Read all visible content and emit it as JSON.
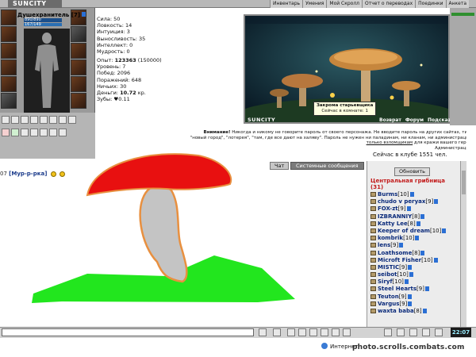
{
  "topbar": {
    "logo": "SUNCITY",
    "menu": [
      "Инвентарь",
      "Умения",
      "Мой Скролл",
      "Отчет о переводах",
      "Поединки",
      "Анкета"
    ]
  },
  "character": {
    "name": "Душехранитель",
    "level": "[7]",
    "hp": "890/890",
    "mp": "167/149"
  },
  "stats": {
    "lines": [
      "Сила: 50",
      "Ловкость: 14",
      "Интуиция: 3",
      "Выносливость: 35",
      "Интеллект: 0",
      "Мудрость: 0"
    ],
    "exp_label": "Опыт:",
    "exp_value": "123363",
    "exp_next": "(150000)",
    "level_line": "Уровень: 7",
    "wins": "Побед: 2096",
    "losses": "Поражений: 648",
    "draws": "Ничьих: 30",
    "money_label": "Деньги:",
    "money_value": "10.72",
    "money_unit": "кр.",
    "teeth": "Зубы: ♥0.11"
  },
  "scene": {
    "brand": "SUNCITY",
    "tooltip_title": "Закрома старьевщика",
    "tooltip_sub": "Сейчас в комнате: 1",
    "links": [
      "Возврат",
      "Форум",
      "Подсказка"
    ]
  },
  "warning": {
    "line1_bold": "Внимание!",
    "line1": " Никогда и никому не говорите пароль от своего персонажа. Не вводите пароль на других сайтах, типа",
    "line2": "\"новый город\", \"лотерея\", \"там, где все дают на халяву\". Пароль не нужен ни паладинам, ни кланам, ни администрации,",
    "line3a": "только взломщикам",
    "line3b": " для кражи вашего героя.",
    "line4": "Администрация."
  },
  "club_line": "Сейчас в клубе 1551 чел.",
  "tabs": {
    "chat": "Чат",
    "system": "Системные сообщения"
  },
  "chat": {
    "time": "07",
    "nick": "[Мур-р-рка]"
  },
  "room": {
    "refresh": "Обновить",
    "title": "Центральная грибница",
    "count": "(31)"
  },
  "users": [
    {
      "name": "Burms",
      "level": "[10]"
    },
    {
      "name": "chudo v peryax",
      "level": "[9]"
    },
    {
      "name": "FOX-zt",
      "level": "[9]"
    },
    {
      "name": "IZBRANNIY",
      "level": "[8]"
    },
    {
      "name": "Katty Lee",
      "level": "[8]"
    },
    {
      "name": "Keeper of dream",
      "level": "[10]"
    },
    {
      "name": "kombrik",
      "level": "[10]"
    },
    {
      "name": "lens",
      "level": "[9]"
    },
    {
      "name": "Loathsome",
      "level": "[8]"
    },
    {
      "name": "Microft Fisher",
      "level": "[10]"
    },
    {
      "name": "MISTIC",
      "level": "[9]"
    },
    {
      "name": "seibot",
      "level": "[10]"
    },
    {
      "name": "Siryf",
      "level": "[10]"
    },
    {
      "name": "Steel Hearts",
      "level": "[9]"
    },
    {
      "name": "Teuton",
      "level": "[9]"
    },
    {
      "name": "Vargus",
      "level": "[9]"
    },
    {
      "name": "waxta baba",
      "level": "[8]"
    }
  ],
  "clock": "22:07",
  "statusbar": {
    "internet": "Интернет",
    "watermark": "photo.scrolls.combats.com"
  },
  "colors": {
    "mushroom_cap": "#e81010",
    "mushroom_stem": "#c4c4c4",
    "mushroom_outline": "#e89040",
    "grass": "#22e61e",
    "room_title": "#c21b1b",
    "nick": "#0a2a7a"
  }
}
